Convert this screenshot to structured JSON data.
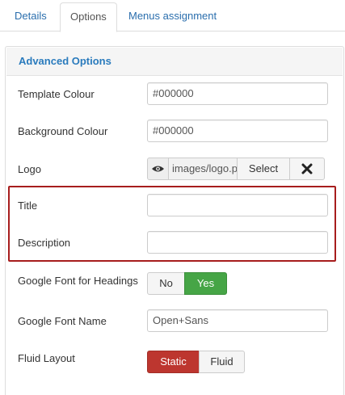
{
  "tabs": {
    "details": "Details",
    "options": "Options",
    "menus": "Menus assignment"
  },
  "panel": {
    "legend": "Advanced Options"
  },
  "fields": {
    "template_colour": {
      "label": "Template Colour",
      "value": "#000000"
    },
    "background_colour": {
      "label": "Background Colour",
      "value": "#000000"
    },
    "logo": {
      "label": "Logo",
      "value": "images/logo.png",
      "select_label": "Select",
      "clear_icon": "close-icon",
      "preview_icon": "eye-icon"
    },
    "title": {
      "label": "Title",
      "value": ""
    },
    "description": {
      "label": "Description",
      "value": ""
    },
    "google_font_headings": {
      "label": "Google Font for Headings",
      "options": [
        "No",
        "Yes"
      ],
      "selected": "Yes"
    },
    "google_font_name": {
      "label": "Google Font Name",
      "value": "Open+Sans"
    },
    "fluid_layout": {
      "label": "Fluid Layout",
      "options": [
        "Static",
        "Fluid"
      ],
      "selected": "Static"
    }
  },
  "colors": {
    "accent": "#2a7bbd",
    "highlight_border": "#a71d1d",
    "yes_active": "#46a546",
    "static_active": "#bd362f"
  }
}
